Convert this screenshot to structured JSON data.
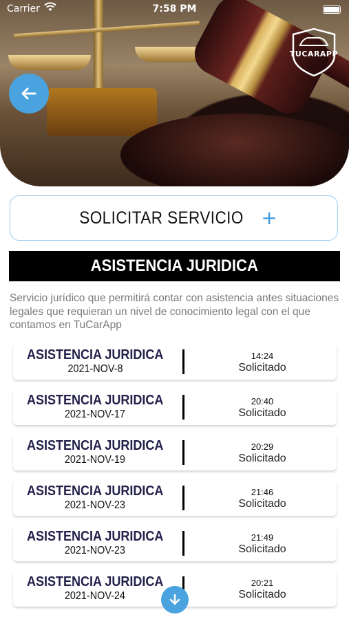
{
  "status_bar": {
    "carrier": "Carrier",
    "time": "7:58 PM"
  },
  "logo": {
    "text": "TUCARAPP"
  },
  "request_button": {
    "label": "SOLICITAR SERVICIO",
    "icon": "+"
  },
  "section": {
    "title": "ASISTENCIA JURIDICA",
    "description": "Servicio jurídico que permitirá contar con asistencia antes situaciones legales que requieran un nivel de conocimiento legal con el que contamos en TuCarApp"
  },
  "requests": [
    {
      "title": "ASISTENCIA JURIDICA",
      "date": "2021-NOV-8",
      "time": "14:24",
      "status": "Solicitado"
    },
    {
      "title": "ASISTENCIA JURIDICA",
      "date": "2021-NOV-17",
      "time": "20:40",
      "status": "Solicitado"
    },
    {
      "title": "ASISTENCIA JURIDICA",
      "date": "2021-NOV-19",
      "time": "20:29",
      "status": "Solicitado"
    },
    {
      "title": "ASISTENCIA JURIDICA",
      "date": "2021-NOV-23",
      "time": "21:46",
      "status": "Solicitado"
    },
    {
      "title": "ASISTENCIA JURIDICA",
      "date": "2021-NOV-23",
      "time": "21:49",
      "status": "Solicitado"
    },
    {
      "title": "ASISTENCIA JURIDICA",
      "date": "2021-NOV-24",
      "time": "20:21",
      "status": "Solicitado"
    }
  ],
  "icons": {
    "back": "arrow-left-icon",
    "scroll": "arrow-down-icon",
    "wifi": "wifi-icon",
    "battery": "battery-icon"
  },
  "colors": {
    "accent": "#4aa3df",
    "section_bg": "#000000",
    "title_text": "#23214a",
    "description_text": "#7a7a7a"
  }
}
